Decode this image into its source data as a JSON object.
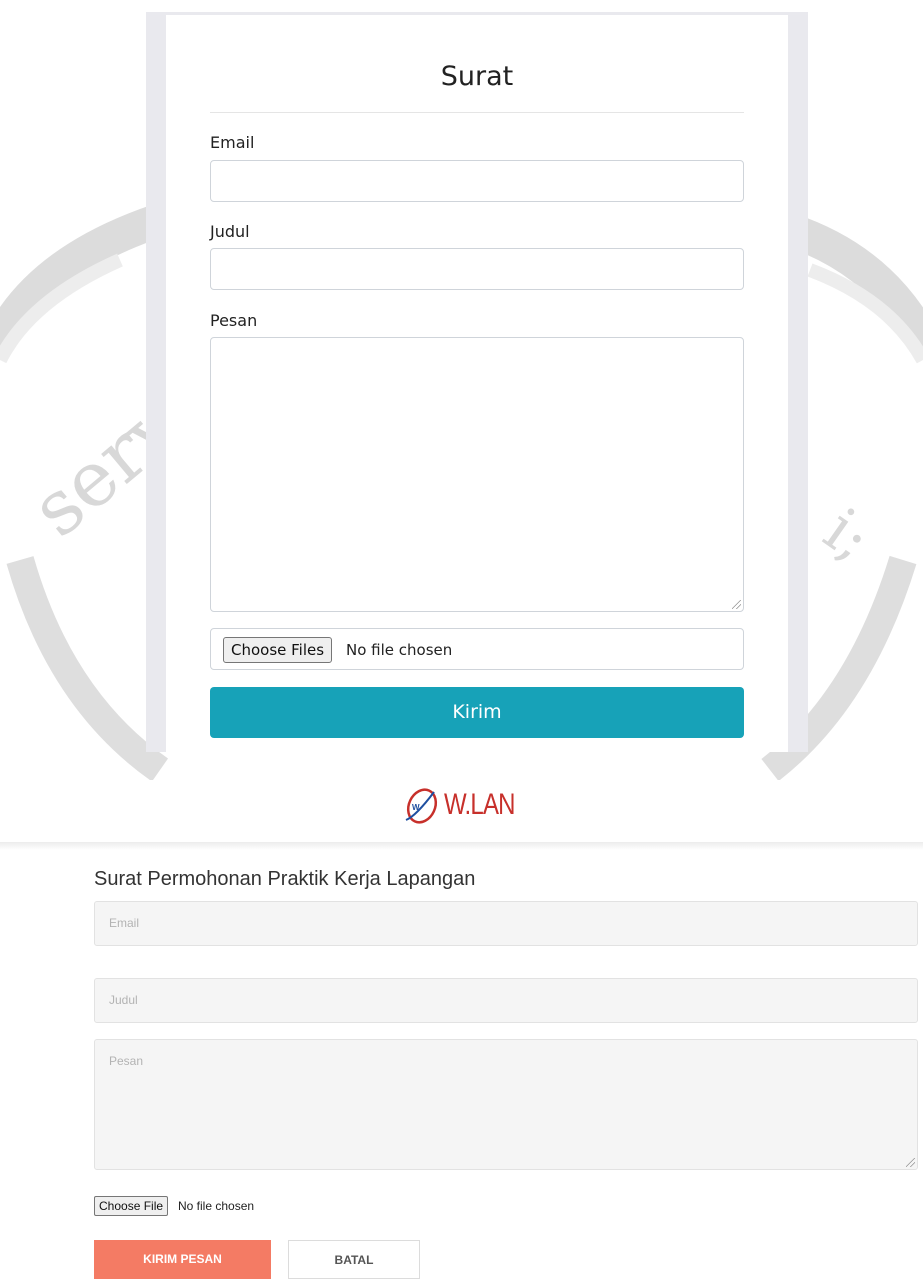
{
  "top_form": {
    "title": "Surat",
    "email_label": "Email",
    "judul_label": "Judul",
    "pesan_label": "Pesan",
    "choose_files_label": "Choose Files",
    "file_status": "No file chosen",
    "submit_label": "Kirim",
    "submit_color": "#17a2b8"
  },
  "logo": {
    "text": "W.LAN",
    "icon": "wlan-logo-icon",
    "color": "#c7302b"
  },
  "bottom_form": {
    "title": "Surat Permohonan Praktik Kerja Lapangan",
    "email_placeholder": "Email",
    "judul_placeholder": "Judul",
    "pesan_placeholder": "Pesan",
    "choose_file_label": "Choose File",
    "file_status": "No file chosen",
    "send_label": "KIRIM PESAN",
    "send_color": "#f47b64",
    "cancel_label": "BATAL"
  }
}
